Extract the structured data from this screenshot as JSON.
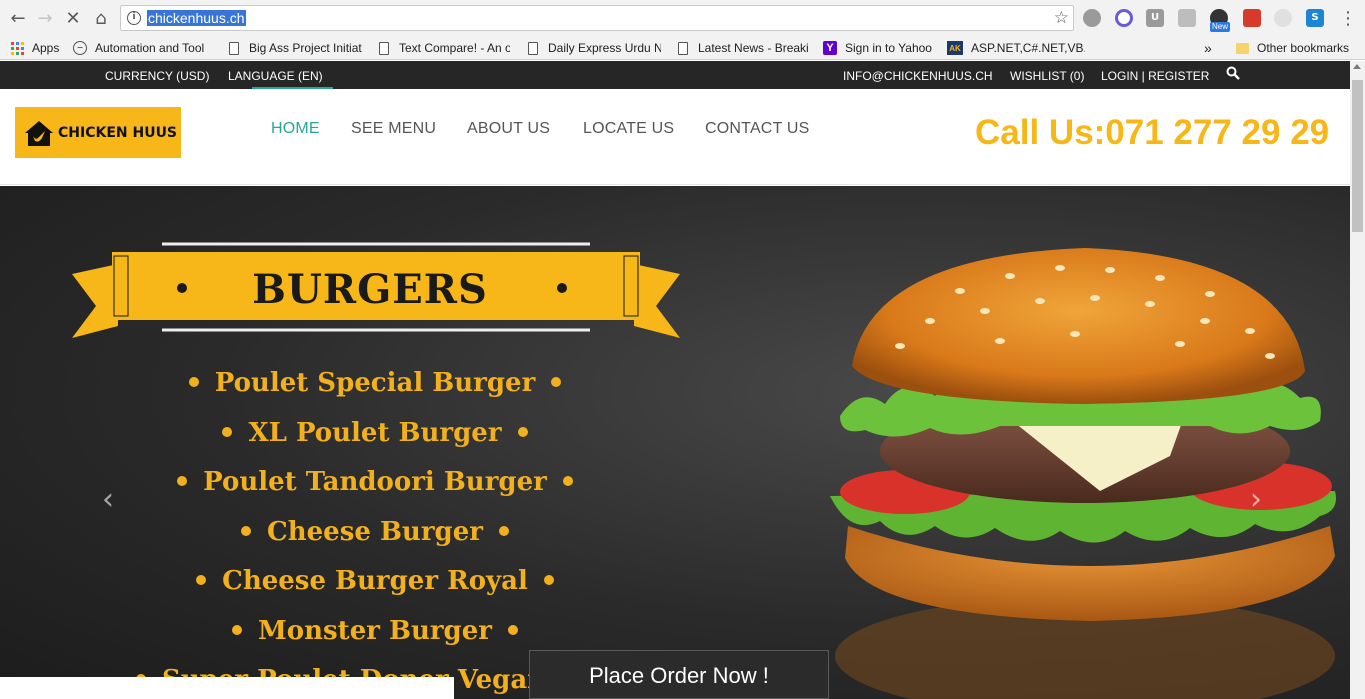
{
  "browser": {
    "url": "chickenhuus.ch",
    "ext_new_badge": "New",
    "bookmarks": [
      {
        "label": "Apps",
        "icon": "apps-grid-icon"
      },
      {
        "label": "Automation and Tool",
        "icon": "minus-circle-icon"
      },
      {
        "label": "Big Ass Project Initiat",
        "icon": "page-icon"
      },
      {
        "label": "Text Compare! - An o",
        "icon": "page-icon"
      },
      {
        "label": "Daily Express Urdu Ne",
        "icon": "page-icon"
      },
      {
        "label": "Latest News - Breakin",
        "icon": "page-icon"
      },
      {
        "label": "Sign in to Yahoo",
        "icon": "yahoo-icon"
      },
      {
        "label": "ASP.NET,C#.NET,VB.N",
        "icon": "ak-icon"
      }
    ],
    "overflow_label": "»",
    "other_bookmarks": "Other bookmarks"
  },
  "topbar": {
    "currency": "CURRENCY (USD)",
    "language": "LANGUAGE (EN)",
    "email": "INFO@CHICKENHUUS.CH",
    "wishlist": "WISHLIST (0)",
    "login": "LOGIN | REGISTER"
  },
  "header": {
    "logo_text": "CHICKEN HUUS",
    "nav": [
      "HOME",
      "SEE MENU",
      "ABOUT US",
      "LOCATE US",
      "CONTACT US"
    ],
    "active_nav": "HOME",
    "call": "Call Us:071 277 29 29"
  },
  "slider": {
    "banner_title": "BURGERS",
    "items": [
      "Poulet Special Burger",
      "XL Poulet Burger",
      "Poulet Tandoori Burger",
      "Cheese Burger",
      "Cheese Burger Royal",
      "Monster Burger",
      "Super Poulet Doner Vegan Burger"
    ],
    "prev_glyph": "‹",
    "next_glyph": "›",
    "order_button": "Place Order Now !"
  },
  "colors": {
    "brand_yellow": "#f7b718",
    "accent_teal": "#26a69a",
    "topbar_bg": "#262626"
  }
}
